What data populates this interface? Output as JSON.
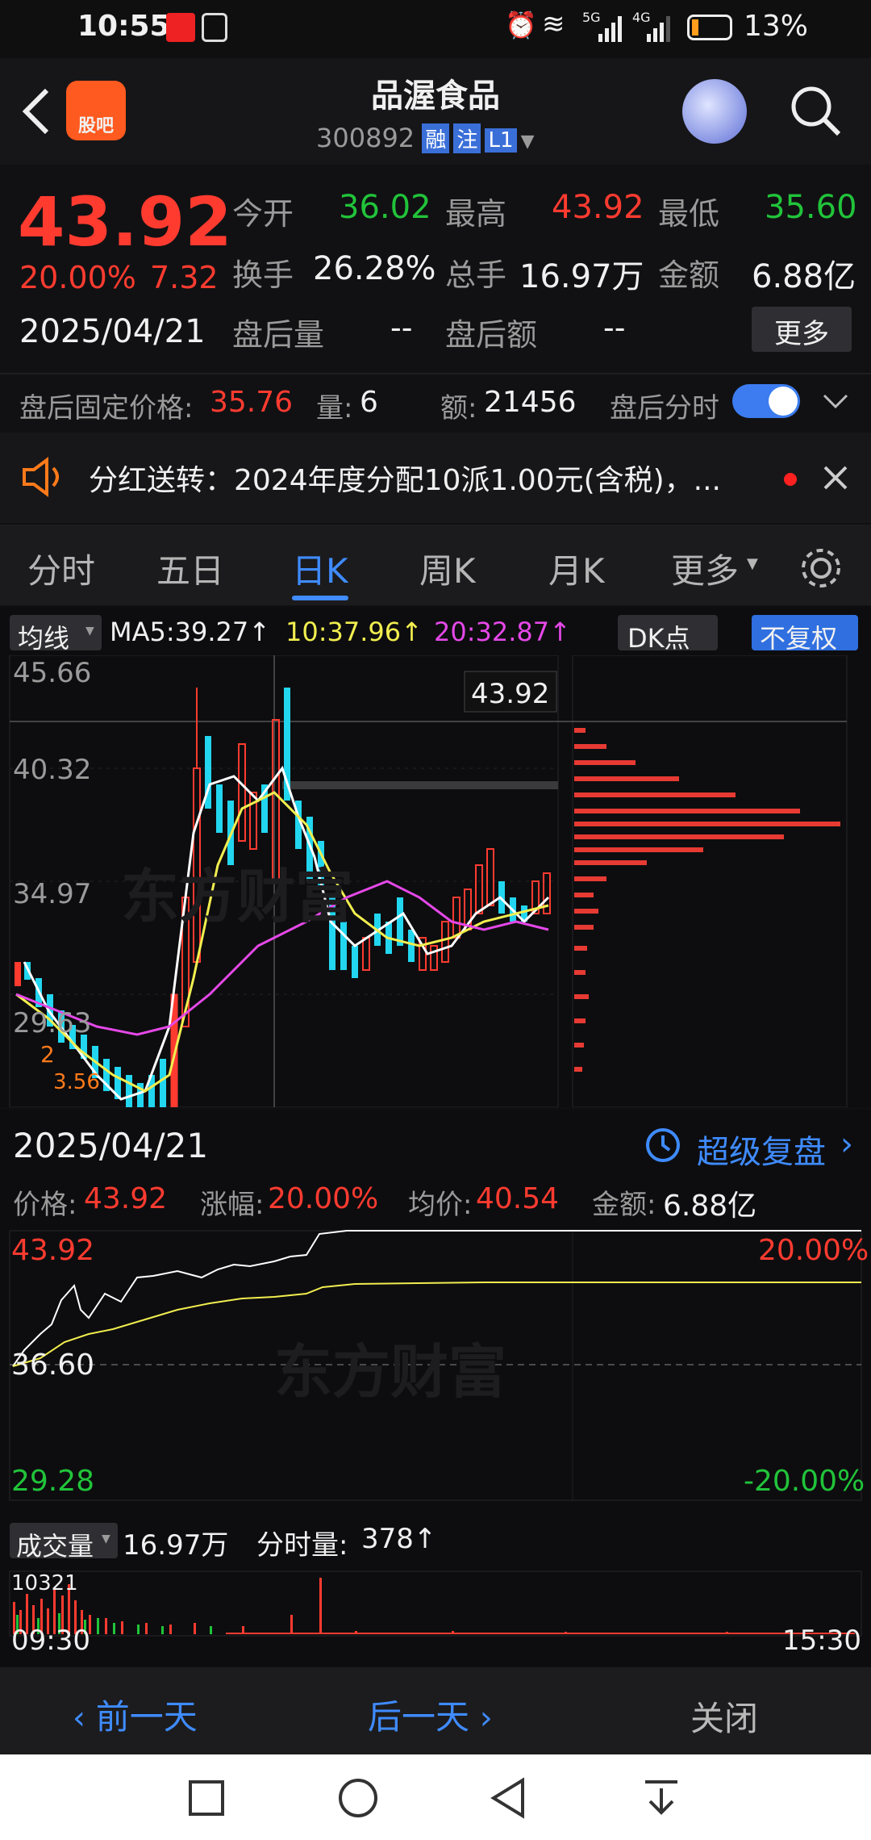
{
  "status_bar": {
    "time": "10:55",
    "carrier_5g": "5G",
    "carrier_4g": "4G",
    "battery": "13%"
  },
  "header": {
    "app_badge": "股吧",
    "stock_name": "品渥食品",
    "stock_code": "300892",
    "tag_margin": "融",
    "tag_register": "注",
    "tag_level": "L1"
  },
  "quote": {
    "price": "43.92",
    "change_pct": "20.00%",
    "change_amt": "7.32",
    "date": "2025/04/21",
    "open_label": "今开",
    "open": "36.02",
    "high_label": "最高",
    "high": "43.92",
    "low_label": "最低",
    "low": "35.60",
    "turnover_label": "换手",
    "turnover": "26.28%",
    "volume_label": "总手",
    "volume": "16.97万",
    "amount_label": "金额",
    "amount": "6.88亿",
    "after_vol_label": "盘后量",
    "after_vol": "--",
    "after_amt_label": "盘后额",
    "after_amt": "--",
    "more_button": "更多",
    "fixed_price_label": "盘后固定价格:",
    "fixed_price": "35.76",
    "fixed_qty_label": "量:",
    "fixed_qty": "6",
    "fixed_amt_label": "额:",
    "fixed_amt": "21456",
    "after_timeshare_label": "盘后分时"
  },
  "notice": {
    "text": "分红送转：2024年度分配10派1.00元(含税)，..."
  },
  "tabs": [
    "分时",
    "五日",
    "日K",
    "周K",
    "月K",
    "更多"
  ],
  "active_tab": 2,
  "kline": {
    "indicator_selector": "均线",
    "ma5": "MA5:39.27↑",
    "ma10": "10:37.96↑",
    "ma20": "20:32.87↑",
    "dk_button": "DK点",
    "adjust_button": "不复权",
    "y_ticks": [
      "45.66",
      "40.32",
      "34.97",
      "29.63"
    ],
    "price_tag": "43.92",
    "marker_labels": [
      "2",
      "3.56"
    ],
    "watermark": "东方财富"
  },
  "intraday": {
    "date": "2025/04/21",
    "replay_button": "超级复盘",
    "price_label": "价格:",
    "price": "43.92",
    "chg_label": "涨幅:",
    "chg": "20.00%",
    "avg_label": "均价:",
    "avg": "40.54",
    "amt_label": "金额:",
    "amt": "6.88亿",
    "y_high": "43.92",
    "y_mid": "36.60",
    "y_low": "29.28",
    "pct_high": "20.00%",
    "pct_low": "-20.00%",
    "volume_selector": "成交量",
    "volume": "16.97万",
    "tick_volume_label": "分时量:",
    "tick_volume": "378↑",
    "vol_max": "10321",
    "time_start": "09:30",
    "time_end": "15:30",
    "watermark": "东方财富"
  },
  "bottom_bar": {
    "prev": "前一天",
    "next": "后一天",
    "close": "关闭"
  },
  "colors": {
    "up": "#ff3b30",
    "down": "#21c43a",
    "accent": "#3f8bff",
    "ma5": "#ffffff",
    "ma10": "#f1ee4f",
    "ma20": "#e548e8"
  }
}
